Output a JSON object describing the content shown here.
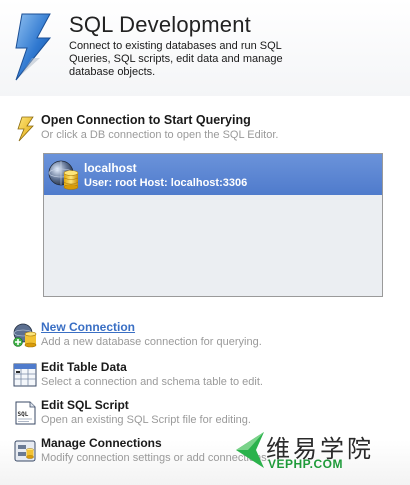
{
  "header": {
    "title": "SQL Development",
    "description": "Connect to existing databases and run SQL Queries, SQL scripts, edit data and manage database objects."
  },
  "open_connection": {
    "title": "Open Connection to Start Querying",
    "subtitle": "Or click a DB connection to open the SQL Editor."
  },
  "connections": [
    {
      "name": "localhost",
      "detail": "User: root  Host: localhost:3306"
    }
  ],
  "actions": [
    {
      "title": "New Connection",
      "subtitle": "Add a new database connection for querying.",
      "icon": "new-connection-icon"
    },
    {
      "title": "Edit Table Data",
      "subtitle": "Select a connection and schema table to edit.",
      "icon": "table-data-icon"
    },
    {
      "title": "Edit SQL Script",
      "subtitle": "Open an existing SQL Script file for editing.",
      "icon": "sql-script-icon"
    },
    {
      "title": "Manage Connections",
      "subtitle": "Modify connection settings or add connections.",
      "icon": "manage-connections-icon"
    }
  ],
  "watermark": {
    "text": "维易学院",
    "site": "VEPHP.COM"
  },
  "colors": {
    "selection": "#5a84d2",
    "link": "#3a6fc4",
    "muted": "#9a9a9a",
    "watermark_green": "#1f9b3a"
  }
}
